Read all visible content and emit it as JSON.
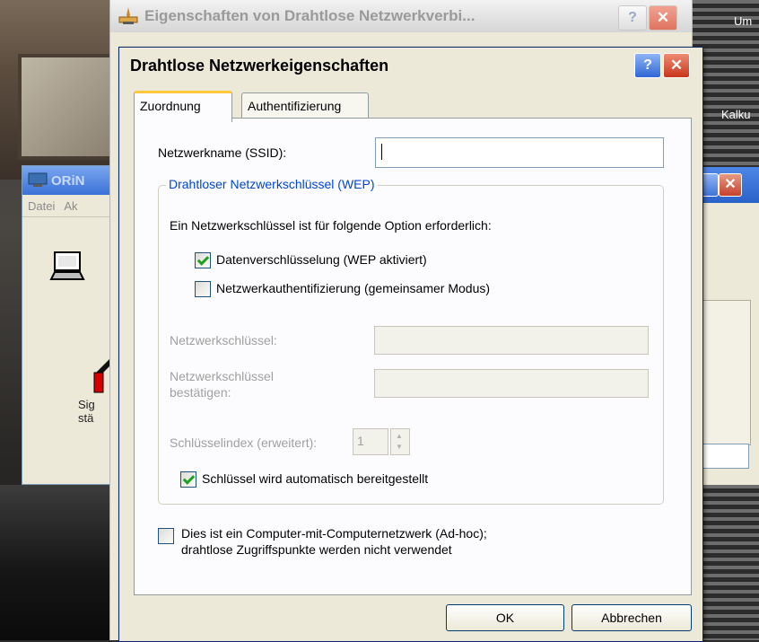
{
  "desktop": {
    "label_top": "Um",
    "label_mid": "Kalku"
  },
  "orinoco": {
    "title": "ORiN",
    "menu": [
      "Datei",
      "Ak"
    ],
    "signal_text_1": "Sig",
    "signal_text_2": "stä"
  },
  "outer_dialog": {
    "title": "Eigenschaften von Drahtlose Netzwerkverbi...",
    "help_label": "?",
    "close_label": "✕"
  },
  "dialog": {
    "title": "Drahtlose Netzwerkeigenschaften",
    "help_label": "?",
    "close_label": "✕",
    "tabs": [
      {
        "label": "Zuordnung",
        "active": true
      },
      {
        "label": "Authentifizierung",
        "active": false
      }
    ],
    "ssid_label": "Netzwerkname (SSID):",
    "ssid_value": "",
    "wep_group": {
      "title": "Drahtloser Netzwerkschlüssel (WEP)",
      "intro": "Ein Netzwerkschlüssel ist für folgende Option erforderlich:",
      "encryption_label": "Datenverschlüsselung (WEP aktiviert)",
      "encryption_checked": true,
      "auth_label": "Netzwerkauthentifizierung (gemeinsamer Modus)",
      "auth_checked": false,
      "key_label": "Netzwerkschlüssel:",
      "confirm_label_1": "Netzwerkschlüssel",
      "confirm_label_2": "bestätigen:",
      "index_label": "Schlüsselindex (erweitert):",
      "index_value": "1",
      "auto_label": "Schlüssel wird automatisch bereitgestellt",
      "auto_checked": true
    },
    "adhoc_line1": "Dies ist ein Computer-mit-Computernetzwerk (Ad-hoc);",
    "adhoc_line2": "drahtlose Zugriffspunkte werden nicht verwendet",
    "adhoc_checked": false,
    "ok_label": "OK",
    "cancel_label": "Abbrechen"
  },
  "colors": {
    "accent_blue": "#0046d5",
    "tab_highlight": "#ffc83c",
    "check_green": "#21a121",
    "close_red": "#c8351c"
  }
}
